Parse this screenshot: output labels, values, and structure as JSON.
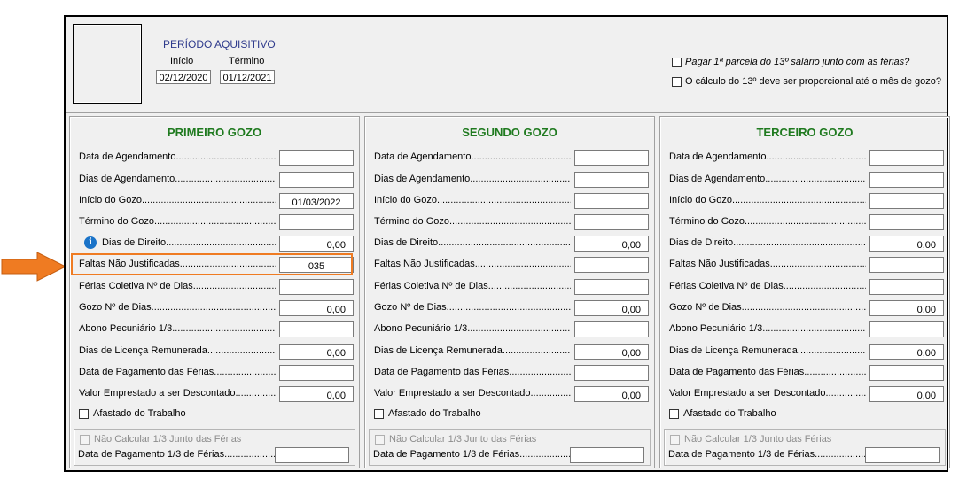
{
  "periodo": {
    "title": "PERÍODO AQUISITIVO",
    "inicio_label": "Início",
    "termino_label": "Término",
    "inicio_value": "02/12/2020",
    "termino_value": "01/12/2021"
  },
  "options": {
    "pagar_13": "Pagar 1ª parcela do 13º salário junto com as férias?",
    "calculo_13": "O cálculo do 13º deve ser proporcional até o mês de gozo?"
  },
  "labels": {
    "data_agendamento": "Data de Agendamento",
    "dias_agendamento": "Dias de Agendamento",
    "inicio_gozo": "Início do Gozo",
    "termino_gozo": "Término do Gozo",
    "dias_direito": "Dias de Direito",
    "faltas": "Faltas Não Justificadas",
    "ferias_coletiva": "Férias Coletiva Nº de Dias",
    "gozo_dias": "Gozo Nº de Dias",
    "abono": "Abono Pecuniário 1/3",
    "licenca": "Dias de Licença Remunerada",
    "pagamento_ferias": "Data de Pagamento das Férias",
    "valor_emprestado": "Valor Emprestado a ser Descontado",
    "afastado": "Afastado do Trabalho",
    "nao_calcular": "Não Calcular 1/3 Junto das Férias",
    "pagamento_13": "Data de Pagamento 1/3 de Férias"
  },
  "columns": [
    {
      "title": "PRIMEIRO GOZO",
      "inicio_gozo": "01/03/2022",
      "dias_direito": "0,00",
      "faltas": "035",
      "gozo_dias": "0,00",
      "licenca": "0,00",
      "valor_emprestado": "0,00"
    },
    {
      "title": "SEGUNDO GOZO",
      "inicio_gozo": "",
      "dias_direito": "0,00",
      "faltas": "",
      "gozo_dias": "0,00",
      "licenca": "0,00",
      "valor_emprestado": "0,00"
    },
    {
      "title": "TERCEIRO GOZO",
      "inicio_gozo": "",
      "dias_direito": "0,00",
      "faltas": "",
      "gozo_dias": "0,00",
      "licenca": "0,00",
      "valor_emprestado": "0,00"
    }
  ],
  "colors": {
    "highlight": "#ef7b22",
    "column_title": "#1f7a1f",
    "periodo_title": "#2e3a8c"
  }
}
